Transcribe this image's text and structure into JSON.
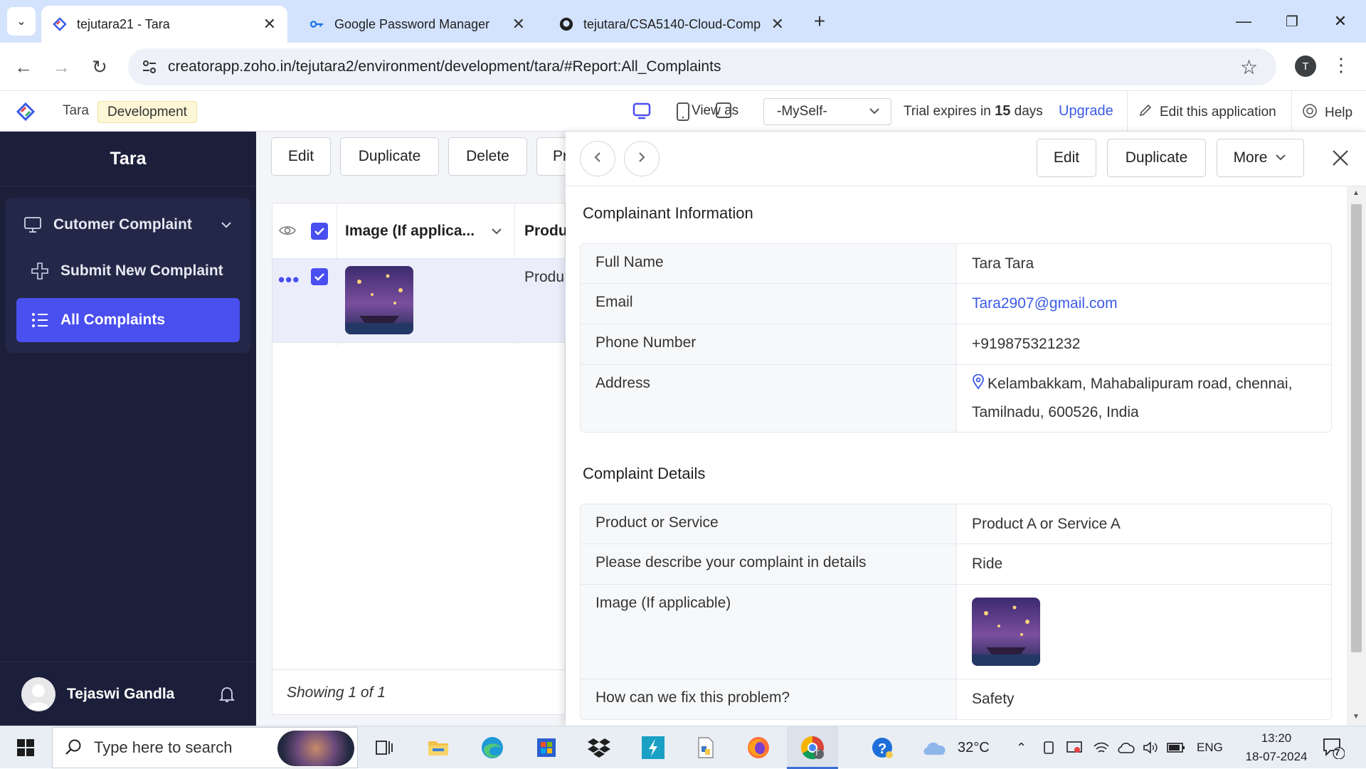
{
  "browser": {
    "tabs": [
      {
        "title": "tejutara21 - Tara",
        "active": true
      },
      {
        "title": "Google Password Manager",
        "active": false
      },
      {
        "title": "tejutara/CSA5140-Cloud-Comp",
        "active": false
      }
    ],
    "url": "creatorapp.zoho.in/tejutara2/environment/development/tara/#Report:All_Complaints",
    "profile_initial": "T"
  },
  "app_header": {
    "app_name": "Tara",
    "environment": "Development",
    "view_as_label": "View as",
    "view_as_value": "-MySelf-",
    "trial_prefix": "Trial expires in",
    "trial_days": "15",
    "trial_suffix": "days",
    "upgrade": "Upgrade",
    "edit_app": "Edit this application",
    "help": "Help"
  },
  "sidebar": {
    "title": "Tara",
    "section": "Cutomer Complaint",
    "items": [
      {
        "label": "Submit New Complaint",
        "active": false
      },
      {
        "label": "All Complaints",
        "active": true
      }
    ],
    "user_name": "Tejaswi Gandla"
  },
  "report": {
    "buttons": [
      "Edit",
      "Duplicate",
      "Delete",
      "Pr"
    ],
    "columns": [
      "Image (If applica...",
      "Produ"
    ],
    "row_cell": "Produ",
    "footer": "Showing 1 of 1"
  },
  "detail": {
    "buttons": {
      "edit": "Edit",
      "duplicate": "Duplicate",
      "more": "More"
    },
    "sections": [
      {
        "title": "Complainant Information",
        "fields": [
          {
            "label": "Full Name",
            "value": "Tara Tara"
          },
          {
            "label": "Email",
            "value": "Tara2907@gmail.com"
          },
          {
            "label": "Phone Number",
            "value": "+919875321232"
          },
          {
            "label": "Address",
            "value": "Kelambakkam, Mahabalipuram road, chennai, Tamilnadu, 600526, India"
          }
        ]
      },
      {
        "title": "Complaint Details",
        "fields": [
          {
            "label": "Product or Service",
            "value": "Product A or Service A"
          },
          {
            "label": "Please describe your complaint in details",
            "value": "Ride"
          },
          {
            "label": "Image (If applicable)",
            "value": ""
          },
          {
            "label": "How can we fix this problem?",
            "value": "Safety"
          }
        ]
      }
    ]
  },
  "taskbar": {
    "search_placeholder": "Type here to search",
    "weather": "32°C",
    "language": "ENG",
    "time": "13:20",
    "date": "18-07-2024",
    "notification_count": "7"
  },
  "colors": {
    "accent": "#4a4ff0",
    "sidebar": "#1b1f3a",
    "link": "#3b5be6",
    "tabstrip": "#d3e3fd"
  }
}
